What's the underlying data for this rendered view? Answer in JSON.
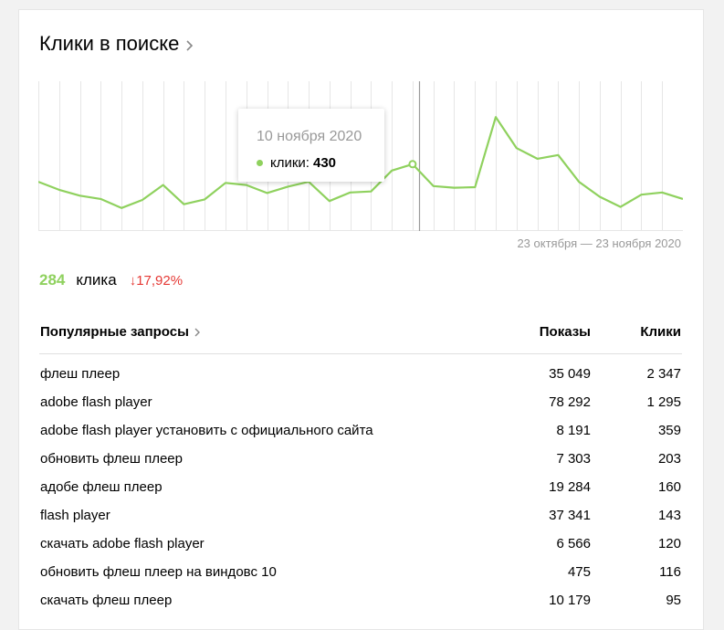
{
  "widget": {
    "title": "Клики в поиске"
  },
  "chart_data": {
    "type": "line",
    "series": [
      {
        "values": [
          312,
          297,
          286,
          280,
          263,
          278,
          306,
          270,
          279,
          310,
          306,
          291,
          303,
          312,
          276,
          292,
          294,
          333,
          345,
          304,
          301,
          302,
          433,
          375,
          355,
          362,
          312,
          284,
          265,
          288,
          292,
          280
        ]
      }
    ],
    "ylim": [
      220,
      500
    ],
    "selected_index": 18,
    "colors": {
      "line": "#8fd15e",
      "grid": "#e6e6e6",
      "cursor": "#999999"
    }
  },
  "tooltip": {
    "date": "10 ноября 2020",
    "series_label": "клики:",
    "value": "430"
  },
  "period": "23 октября — 23 ноября 2020",
  "summary": {
    "count": "284",
    "unit": "клика",
    "change": "↓17,92%"
  },
  "table": {
    "headers": {
      "query": "Популярные запросы",
      "shows": "Показы",
      "clicks": "Клики"
    },
    "rows": [
      {
        "query": "флеш плеер",
        "shows": "35 049",
        "clicks": "2 347"
      },
      {
        "query": "adobe flash player",
        "shows": "78 292",
        "clicks": "1 295"
      },
      {
        "query": "adobe flash player установить с официального сайта",
        "shows": "8 191",
        "clicks": "359"
      },
      {
        "query": "обновить флеш плеер",
        "shows": "7 303",
        "clicks": "203"
      },
      {
        "query": "адобе флеш плеер",
        "shows": "19 284",
        "clicks": "160"
      },
      {
        "query": "flash player",
        "shows": "37 341",
        "clicks": "143"
      },
      {
        "query": "скачать adobe flash player",
        "shows": "6 566",
        "clicks": "120"
      },
      {
        "query": "обновить флеш плеер на виндовс 10",
        "shows": "475",
        "clicks": "116"
      },
      {
        "query": "скачать флеш плеер",
        "shows": "10 179",
        "clicks": "95"
      }
    ]
  }
}
